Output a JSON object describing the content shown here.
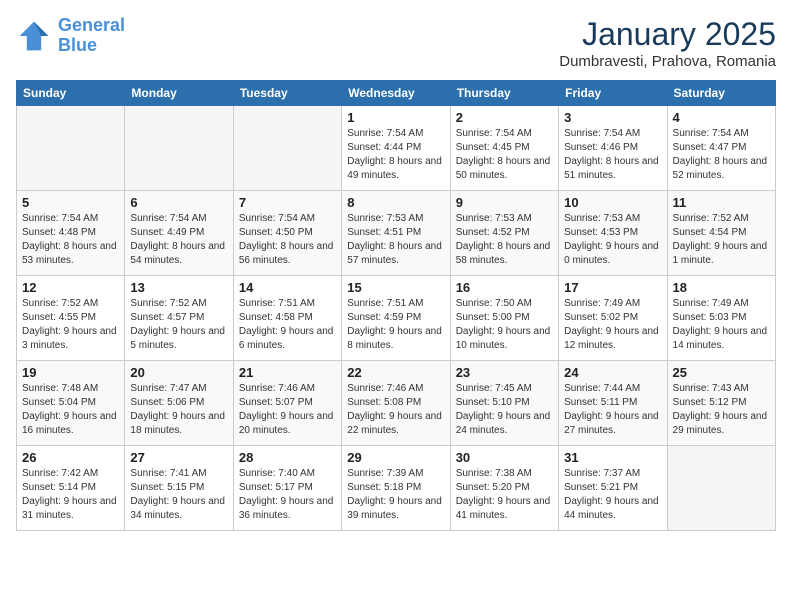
{
  "logo": {
    "line1": "General",
    "line2": "Blue"
  },
  "title": "January 2025",
  "location": "Dumbravesti, Prahova, Romania",
  "weekdays": [
    "Sunday",
    "Monday",
    "Tuesday",
    "Wednesday",
    "Thursday",
    "Friday",
    "Saturday"
  ],
  "weeks": [
    [
      {
        "day": "",
        "sunrise": "",
        "sunset": "",
        "daylight": ""
      },
      {
        "day": "",
        "sunrise": "",
        "sunset": "",
        "daylight": ""
      },
      {
        "day": "",
        "sunrise": "",
        "sunset": "",
        "daylight": ""
      },
      {
        "day": "1",
        "sunrise": "Sunrise: 7:54 AM",
        "sunset": "Sunset: 4:44 PM",
        "daylight": "Daylight: 8 hours and 49 minutes."
      },
      {
        "day": "2",
        "sunrise": "Sunrise: 7:54 AM",
        "sunset": "Sunset: 4:45 PM",
        "daylight": "Daylight: 8 hours and 50 minutes."
      },
      {
        "day": "3",
        "sunrise": "Sunrise: 7:54 AM",
        "sunset": "Sunset: 4:46 PM",
        "daylight": "Daylight: 8 hours and 51 minutes."
      },
      {
        "day": "4",
        "sunrise": "Sunrise: 7:54 AM",
        "sunset": "Sunset: 4:47 PM",
        "daylight": "Daylight: 8 hours and 52 minutes."
      }
    ],
    [
      {
        "day": "5",
        "sunrise": "Sunrise: 7:54 AM",
        "sunset": "Sunset: 4:48 PM",
        "daylight": "Daylight: 8 hours and 53 minutes."
      },
      {
        "day": "6",
        "sunrise": "Sunrise: 7:54 AM",
        "sunset": "Sunset: 4:49 PM",
        "daylight": "Daylight: 8 hours and 54 minutes."
      },
      {
        "day": "7",
        "sunrise": "Sunrise: 7:54 AM",
        "sunset": "Sunset: 4:50 PM",
        "daylight": "Daylight: 8 hours and 56 minutes."
      },
      {
        "day": "8",
        "sunrise": "Sunrise: 7:53 AM",
        "sunset": "Sunset: 4:51 PM",
        "daylight": "Daylight: 8 hours and 57 minutes."
      },
      {
        "day": "9",
        "sunrise": "Sunrise: 7:53 AM",
        "sunset": "Sunset: 4:52 PM",
        "daylight": "Daylight: 8 hours and 58 minutes."
      },
      {
        "day": "10",
        "sunrise": "Sunrise: 7:53 AM",
        "sunset": "Sunset: 4:53 PM",
        "daylight": "Daylight: 9 hours and 0 minutes."
      },
      {
        "day": "11",
        "sunrise": "Sunrise: 7:52 AM",
        "sunset": "Sunset: 4:54 PM",
        "daylight": "Daylight: 9 hours and 1 minute."
      }
    ],
    [
      {
        "day": "12",
        "sunrise": "Sunrise: 7:52 AM",
        "sunset": "Sunset: 4:55 PM",
        "daylight": "Daylight: 9 hours and 3 minutes."
      },
      {
        "day": "13",
        "sunrise": "Sunrise: 7:52 AM",
        "sunset": "Sunset: 4:57 PM",
        "daylight": "Daylight: 9 hours and 5 minutes."
      },
      {
        "day": "14",
        "sunrise": "Sunrise: 7:51 AM",
        "sunset": "Sunset: 4:58 PM",
        "daylight": "Daylight: 9 hours and 6 minutes."
      },
      {
        "day": "15",
        "sunrise": "Sunrise: 7:51 AM",
        "sunset": "Sunset: 4:59 PM",
        "daylight": "Daylight: 9 hours and 8 minutes."
      },
      {
        "day": "16",
        "sunrise": "Sunrise: 7:50 AM",
        "sunset": "Sunset: 5:00 PM",
        "daylight": "Daylight: 9 hours and 10 minutes."
      },
      {
        "day": "17",
        "sunrise": "Sunrise: 7:49 AM",
        "sunset": "Sunset: 5:02 PM",
        "daylight": "Daylight: 9 hours and 12 minutes."
      },
      {
        "day": "18",
        "sunrise": "Sunrise: 7:49 AM",
        "sunset": "Sunset: 5:03 PM",
        "daylight": "Daylight: 9 hours and 14 minutes."
      }
    ],
    [
      {
        "day": "19",
        "sunrise": "Sunrise: 7:48 AM",
        "sunset": "Sunset: 5:04 PM",
        "daylight": "Daylight: 9 hours and 16 minutes."
      },
      {
        "day": "20",
        "sunrise": "Sunrise: 7:47 AM",
        "sunset": "Sunset: 5:06 PM",
        "daylight": "Daylight: 9 hours and 18 minutes."
      },
      {
        "day": "21",
        "sunrise": "Sunrise: 7:46 AM",
        "sunset": "Sunset: 5:07 PM",
        "daylight": "Daylight: 9 hours and 20 minutes."
      },
      {
        "day": "22",
        "sunrise": "Sunrise: 7:46 AM",
        "sunset": "Sunset: 5:08 PM",
        "daylight": "Daylight: 9 hours and 22 minutes."
      },
      {
        "day": "23",
        "sunrise": "Sunrise: 7:45 AM",
        "sunset": "Sunset: 5:10 PM",
        "daylight": "Daylight: 9 hours and 24 minutes."
      },
      {
        "day": "24",
        "sunrise": "Sunrise: 7:44 AM",
        "sunset": "Sunset: 5:11 PM",
        "daylight": "Daylight: 9 hours and 27 minutes."
      },
      {
        "day": "25",
        "sunrise": "Sunrise: 7:43 AM",
        "sunset": "Sunset: 5:12 PM",
        "daylight": "Daylight: 9 hours and 29 minutes."
      }
    ],
    [
      {
        "day": "26",
        "sunrise": "Sunrise: 7:42 AM",
        "sunset": "Sunset: 5:14 PM",
        "daylight": "Daylight: 9 hours and 31 minutes."
      },
      {
        "day": "27",
        "sunrise": "Sunrise: 7:41 AM",
        "sunset": "Sunset: 5:15 PM",
        "daylight": "Daylight: 9 hours and 34 minutes."
      },
      {
        "day": "28",
        "sunrise": "Sunrise: 7:40 AM",
        "sunset": "Sunset: 5:17 PM",
        "daylight": "Daylight: 9 hours and 36 minutes."
      },
      {
        "day": "29",
        "sunrise": "Sunrise: 7:39 AM",
        "sunset": "Sunset: 5:18 PM",
        "daylight": "Daylight: 9 hours and 39 minutes."
      },
      {
        "day": "30",
        "sunrise": "Sunrise: 7:38 AM",
        "sunset": "Sunset: 5:20 PM",
        "daylight": "Daylight: 9 hours and 41 minutes."
      },
      {
        "day": "31",
        "sunrise": "Sunrise: 7:37 AM",
        "sunset": "Sunset: 5:21 PM",
        "daylight": "Daylight: 9 hours and 44 minutes."
      },
      {
        "day": "",
        "sunrise": "",
        "sunset": "",
        "daylight": ""
      }
    ]
  ]
}
